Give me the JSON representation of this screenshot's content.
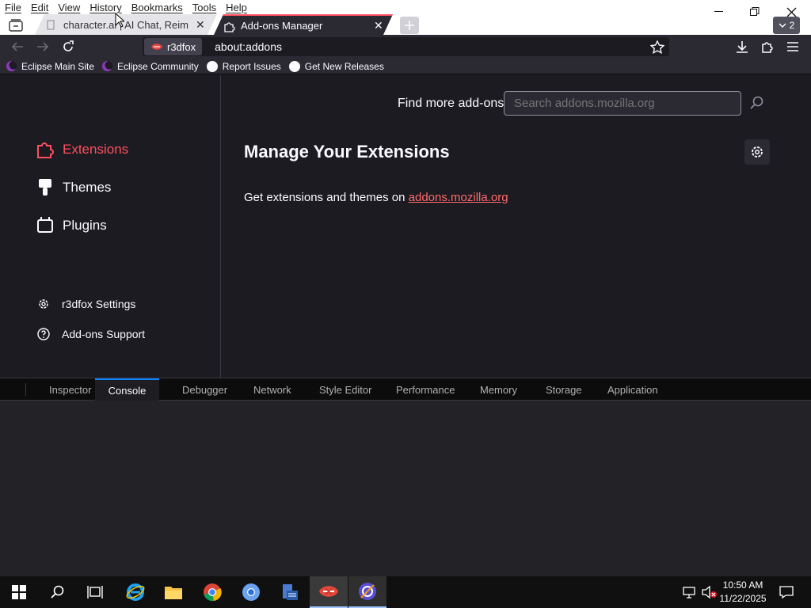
{
  "menu": [
    "File",
    "Edit",
    "View",
    "History",
    "Bookmarks",
    "Tools",
    "Help"
  ],
  "tabs": [
    {
      "label": "character.ai | AI Chat, Reimagine",
      "active": false
    },
    {
      "label": "Add-ons Manager",
      "active": true
    }
  ],
  "tab_count": "2",
  "urlbar": {
    "identity": "r3dfox",
    "url": "about:addons"
  },
  "bookmarks": [
    "Eclipse Main Site",
    "Eclipse Community",
    "Report Issues",
    "Get New Releases"
  ],
  "sidebar": {
    "categories": [
      {
        "label": "Extensions",
        "selected": true
      },
      {
        "label": "Themes",
        "selected": false
      },
      {
        "label": "Plugins",
        "selected": false
      }
    ],
    "settings_label": "r3dfox Settings",
    "support_label": "Add-ons Support"
  },
  "main": {
    "find_more": "Find more add-ons",
    "search_placeholder": "Search addons.mozilla.org",
    "heading": "Manage Your Extensions",
    "intro_text": "Get extensions and themes on ",
    "intro_link": "addons.mozilla.org"
  },
  "devtools": {
    "tabs": [
      "Inspector",
      "Console",
      "Debugger",
      "Network",
      "Style Editor",
      "Performance",
      "Memory",
      "Storage",
      "Application"
    ],
    "selected": "Console"
  },
  "taskbar": {
    "time": "10:50 AM",
    "date": "11/22/2025"
  },
  "colors": {
    "accent": "#ff4f5e",
    "link": "#ff6b6b",
    "devtools_selected": "#0a84ff"
  }
}
